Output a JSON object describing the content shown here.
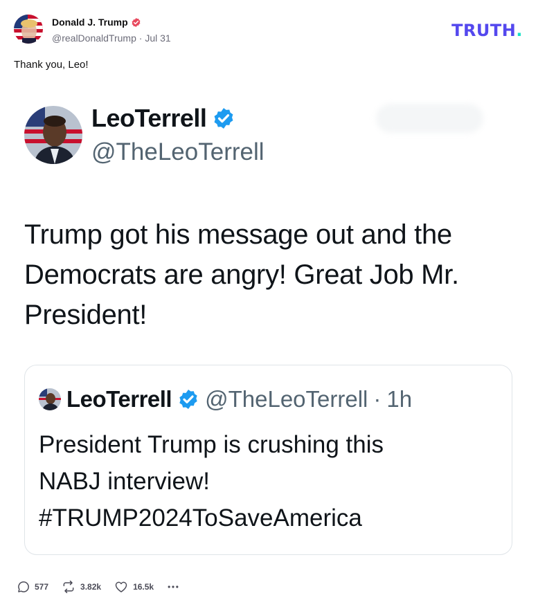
{
  "post": {
    "author_name": "Donald J. Trump",
    "handle": "@realDonaldTrump",
    "separator": "·",
    "date": "Jul 31",
    "text": "Thank you, Leo!",
    "brand": {
      "word": "TRUTH",
      "dot": ".",
      "color": "#5448ee",
      "dot_color": "#17e2c7"
    },
    "verified_icon": "verified-badge-icon",
    "verified_color": "#e8495e"
  },
  "embed": {
    "name": "LeoTerrell",
    "handle": "@TheLeoTerrell",
    "text": "Trump got his message out and the Democrats are angry! Great Job Mr. President!",
    "verified_color": "#1d9bf0",
    "quote": {
      "name": "LeoTerrell",
      "handle": "@TheLeoTerrell",
      "separator": "·",
      "time": "1h",
      "lines": [
        "President Trump is crushing this",
        "NABJ interview!",
        "#TRUMP2024ToSaveAmerica"
      ]
    }
  },
  "actions": {
    "replies": "577",
    "retruths": "3.82k",
    "likes": "16.5k",
    "more_icon": "more-icon"
  }
}
